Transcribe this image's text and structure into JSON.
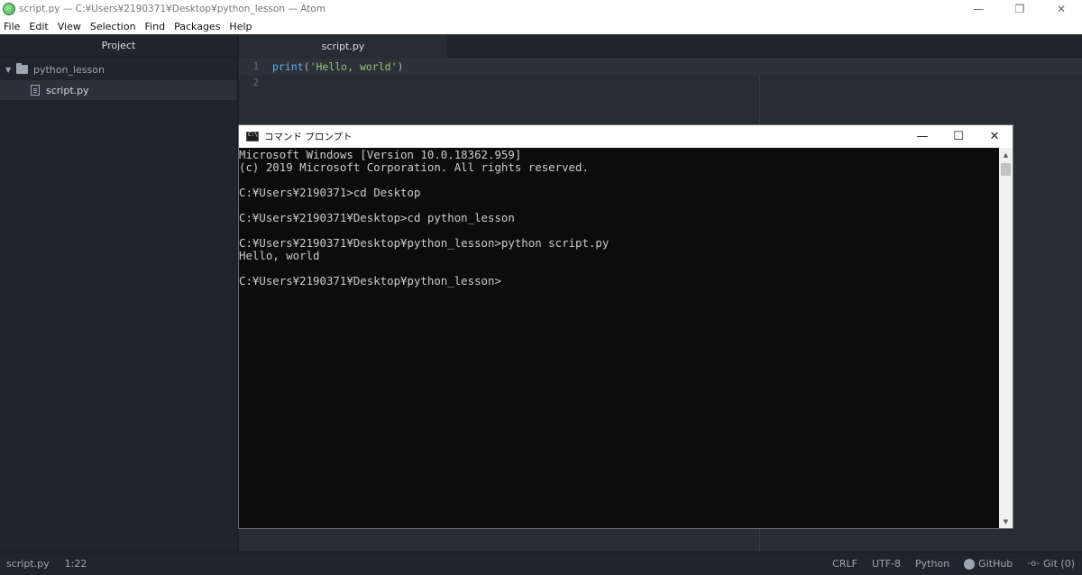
{
  "window": {
    "title": "script.py — C:¥Users¥2190371¥Desktop¥python_lesson — Atom",
    "minimize": "—",
    "restore": "❐",
    "close": "✕"
  },
  "menu": [
    "File",
    "Edit",
    "View",
    "Selection",
    "Find",
    "Packages",
    "Help"
  ],
  "tree": {
    "header": "Project",
    "folder": "python_lesson",
    "file": "script.py"
  },
  "editor": {
    "tab": "script.py",
    "lines": [
      {
        "num": "1",
        "fn": "print",
        "open": "(",
        "str": "'Hello, world'",
        "close": ")"
      },
      {
        "num": "2"
      }
    ]
  },
  "cmd": {
    "title": "コマンド プロンプト",
    "minimize": "—",
    "maximize": "☐",
    "close": "✕",
    "output": "Microsoft Windows [Version 10.0.18362.959]\n(c) 2019 Microsoft Corporation. All rights reserved.\n\nC:¥Users¥2190371>cd Desktop\n\nC:¥Users¥2190371¥Desktop>cd python_lesson\n\nC:¥Users¥2190371¥Desktop¥python_lesson>python script.py\nHello, world\n\nC:¥Users¥2190371¥Desktop¥python_lesson>",
    "scroll_up": "▲",
    "scroll_down": "▼"
  },
  "status": {
    "file": "script.py",
    "cursor": "1:22",
    "line_ending": "CRLF",
    "encoding": "UTF-8",
    "grammar": "Python",
    "github": "GitHub",
    "git": "Git (0)"
  }
}
